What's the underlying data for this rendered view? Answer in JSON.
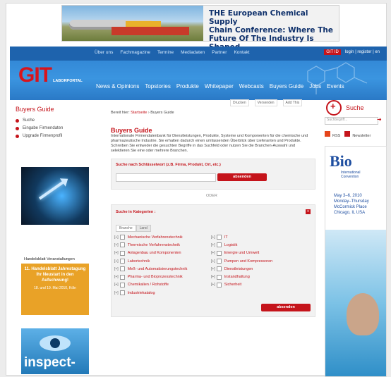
{
  "banner": {
    "line1": "THE European Chemical Supply",
    "line2": "Chain Conference: Where The",
    "line3": "Future Of The Industry Is Shaped"
  },
  "header": {
    "top_nav": [
      "Über uns",
      "Fachmagazine",
      "Termine",
      "Mediadaten",
      "Partner",
      "Kontakt"
    ],
    "login_label": "GIT ID",
    "login_links": "login | register | en",
    "brand": "GIT",
    "brand_suffix": "LABORPORTAL",
    "main_nav": [
      "News & Opinions",
      "Topstories",
      "Produkte",
      "Whitepaper",
      "Webcasts",
      "Buyers Guide",
      "Jobs",
      "Events"
    ]
  },
  "sidebar": {
    "title": "Buyers Guide",
    "items": [
      "Suche",
      "Eingabe Firmendaten",
      "Upgrade Firmenprofil"
    ]
  },
  "ads": {
    "handelsblatt": {
      "publisher": "Handelsblatt Veranstaltungen",
      "headline": "11. Handelsblatt Jahrestagung Ihr Neustart in den Aufschwung!",
      "date": "18. und 19. Mai 2010, Köln"
    },
    "inspect": "inspect-"
  },
  "tools": [
    "Drucken",
    "Versenden",
    "Add This"
  ],
  "breadcrumb": {
    "label": "Bereit hier:",
    "link": "Startseite",
    "current": "Buyers Guide"
  },
  "page_title": "Buyers Guide",
  "intro": "Internationale Firmendatenbank für Dienstleistungen, Produkte, Systeme und Komponenten für die chemische und pharmazeutische Industrie. Sie erhalten dadurch einen umfassenden Überblick über Lieferanten und Produkte. Schreiben Sie entweder die gesuchten Begriffe in das Suchfeld oder nutzen Sie die Branchen-Auswahl und selektieren Sie eine oder mehrere Branchen.",
  "keyword_search": {
    "label": "Suche nach Schlüsselwort (z.B. Firma, Produkt, Ort, etc.)",
    "placeholder": "",
    "button": "absenden"
  },
  "or_text": "ODER",
  "category_search": {
    "label": "Suche in Kategorien :",
    "tabs": [
      "Branche",
      "Land"
    ],
    "left": [
      "Mechanische Verfahrenstechnik",
      "Thermische Verfahrenstechnik",
      "Anlagenbau und Komponenten",
      "Labortechnik",
      "Meß- und Automatisierungstechnik",
      "Pharma- und Bioprozesstechnik",
      "Chemikalien / Rohstoffe",
      "Industriekatalog"
    ],
    "right": [
      "IT",
      "Logistik",
      "Energie und Umwelt",
      "Pumpen und Kompressoren",
      "Dienstleistungen",
      "Instandhaltung",
      "Sicherheit"
    ],
    "button": "absenden"
  },
  "right": {
    "search_title": "Suche",
    "search_placeholder": "Suchbegriff...",
    "rss": "RSS",
    "newsletter": "Newsletter",
    "bio": {
      "name": "Bio",
      "sub1": "International",
      "sub2": "Convention",
      "dates": [
        "May 3–6, 2010",
        "Monday–Thursday",
        "McCormick Place",
        "Chicago, IL USA"
      ]
    }
  },
  "colors": {
    "accent": "#c5141b",
    "header_blue": "#2d7fd0"
  }
}
